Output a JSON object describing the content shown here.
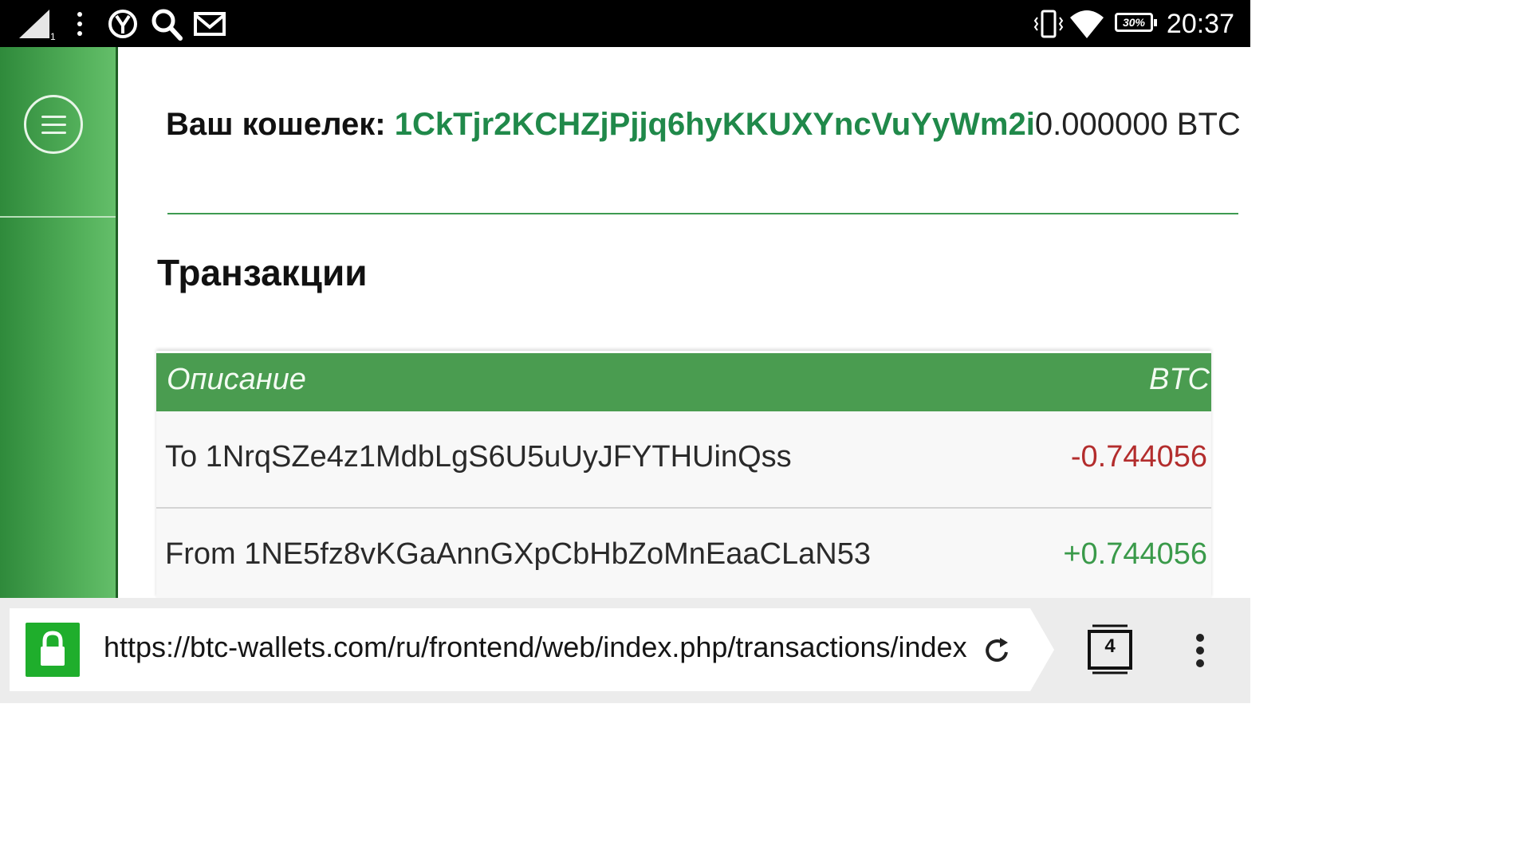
{
  "status_bar": {
    "time": "20:37",
    "battery": "30%",
    "signal_sub": "1",
    "icons": [
      "signal-icon",
      "more-vert-icon",
      "yandex-icon",
      "search-icon",
      "mail-icon",
      "vibrate-icon",
      "wifi-icon",
      "battery-icon"
    ]
  },
  "sidebar": {
    "menu_icon": "hamburger-icon"
  },
  "wallet": {
    "label": "Ваш кошелек:",
    "address": "1CkTjr2KCHZjPjjq6hyKKUXYncVuYyWm2i",
    "balance": "0.000000 BTC"
  },
  "transactions": {
    "title": "Транзакции",
    "columns": [
      "Описание",
      "BTC"
    ],
    "rows": [
      {
        "description": "To 1NrqSZe4z1MdbLgS6U5uUyJFYTHUinQss",
        "amount": "-0.744056"
      },
      {
        "description": "From 1NE5fz8vKGaAnnGXpCbHbZoMnEaaCLaN53",
        "amount": "+0.744056"
      }
    ]
  },
  "colors": {
    "accent": "#4a9c50",
    "address": "#20894a",
    "negative": "#b32d2d",
    "positive": "#3a9a4a",
    "lock": "#1fae2c"
  },
  "browser": {
    "url": "https://btc-wallets.com/ru/frontend/web/index.php/transactions/index",
    "tab_count": "4"
  }
}
